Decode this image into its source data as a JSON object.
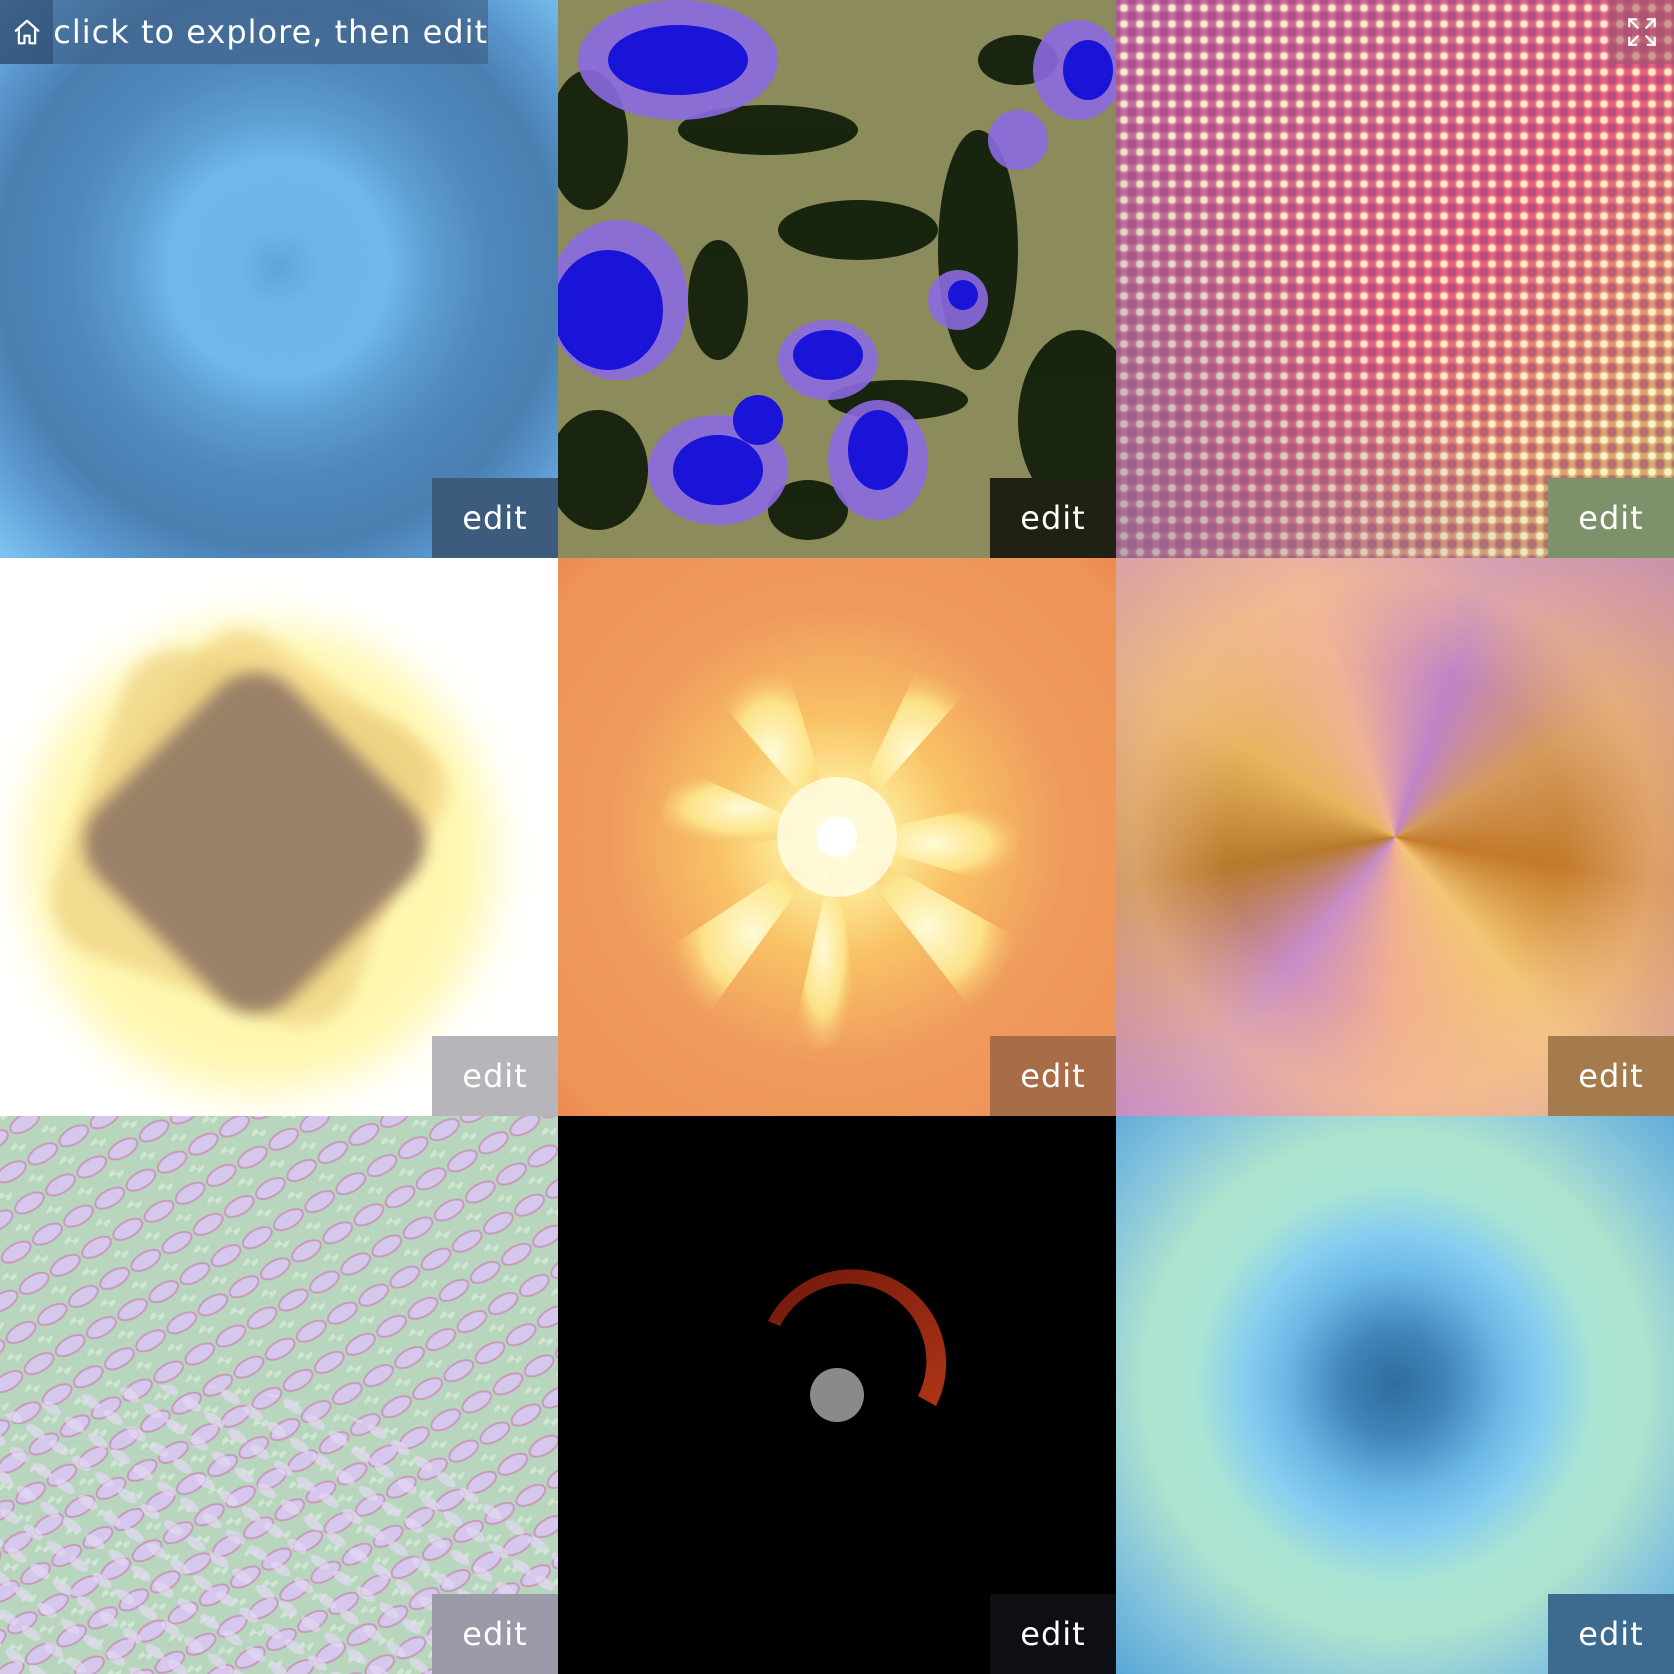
{
  "header": {
    "hint_text": "click to explore, then edit",
    "home_icon": "home-icon",
    "fullscreen_icon": "fullscreen-icon"
  },
  "tiles": [
    {
      "edit_label": "edit",
      "edit_bg": "#3d5c7d"
    },
    {
      "edit_label": "edit",
      "edit_bg": "#1f2213"
    },
    {
      "edit_label": "edit",
      "edit_bg": "#7d916a"
    },
    {
      "edit_label": "edit",
      "edit_bg": "#b6b6ba"
    },
    {
      "edit_label": "edit",
      "edit_bg": "#a86c48"
    },
    {
      "edit_label": "edit",
      "edit_bg": "#a57b4e"
    },
    {
      "edit_label": "edit",
      "edit_bg": "#9a9aa8"
    },
    {
      "edit_label": "edit",
      "edit_bg": "#0d0f14"
    },
    {
      "edit_label": "edit",
      "edit_bg": "#3d6a8f"
    }
  ]
}
